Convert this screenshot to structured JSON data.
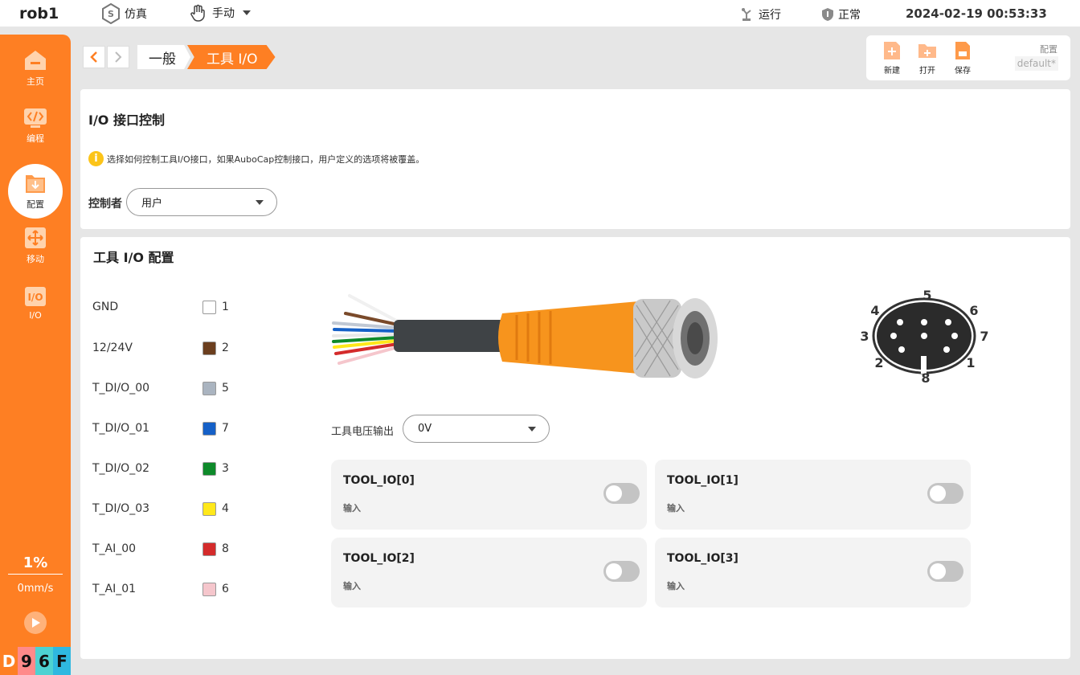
{
  "topbar": {
    "robot_name": "rob1",
    "sim_label": "仿真",
    "mode_label": "手动",
    "run_label": "运行",
    "status_label": "正常",
    "datetime": "2024-02-19 00:53:33"
  },
  "sidebar": {
    "items": [
      {
        "label": "主页",
        "icon": "home-icon"
      },
      {
        "label": "编程",
        "icon": "code-icon"
      },
      {
        "label": "配置",
        "icon": "config-icon"
      },
      {
        "label": "移动",
        "icon": "move-icon"
      },
      {
        "label": "I/O",
        "icon": "io-icon"
      }
    ],
    "active_index": 2,
    "speed_percent": "1%",
    "speed_mm": "0mm/s",
    "badge": [
      "D",
      "9",
      "6",
      "F"
    ],
    "badge_colors": [
      "#fe7f23",
      "#ff8a8a",
      "#4dd2d2",
      "#2fb8e0"
    ]
  },
  "breadcrumb": {
    "items": [
      "一般",
      "工具 I/O"
    ]
  },
  "file_toolbar": {
    "new_label": "新建",
    "open_label": "打开",
    "save_label": "保存",
    "config_label": "配置",
    "config_value": "default*"
  },
  "io_control": {
    "title": "I/O 接口控制",
    "info_text": "选择如何控制工具I/O接口，如果AuboCap控制接口，用户定义的选项将被覆盖。",
    "controller_label": "控制者",
    "controller_value": "用户"
  },
  "tool_io": {
    "title": "工具 I/O 配置",
    "pins": [
      {
        "name": "GND",
        "color": "#ffffff",
        "num": "1"
      },
      {
        "name": "12/24V",
        "color": "#6b3e1e",
        "num": "2"
      },
      {
        "name": "T_DI/O_00",
        "color": "#aab4c0",
        "num": "5"
      },
      {
        "name": "T_DI/O_01",
        "color": "#1560c7",
        "num": "7"
      },
      {
        "name": "T_DI/O_02",
        "color": "#0e8a2a",
        "num": "3"
      },
      {
        "name": "T_DI/O_03",
        "color": "#ffe81a",
        "num": "4"
      },
      {
        "name": "T_AI_00",
        "color": "#d42b2b",
        "num": "8"
      },
      {
        "name": "T_AI_01",
        "color": "#f5c6cc",
        "num": "6"
      }
    ],
    "connector_pins": [
      "1",
      "2",
      "3",
      "4",
      "5",
      "6",
      "7",
      "8"
    ],
    "voltage_label": "工具电压输出",
    "voltage_value": "0V",
    "io_cards": [
      {
        "title": "TOOL_IO[0]",
        "mode": "输入"
      },
      {
        "title": "TOOL_IO[1]",
        "mode": "输入"
      },
      {
        "title": "TOOL_IO[2]",
        "mode": "输入"
      },
      {
        "title": "TOOL_IO[3]",
        "mode": "输入"
      }
    ]
  }
}
